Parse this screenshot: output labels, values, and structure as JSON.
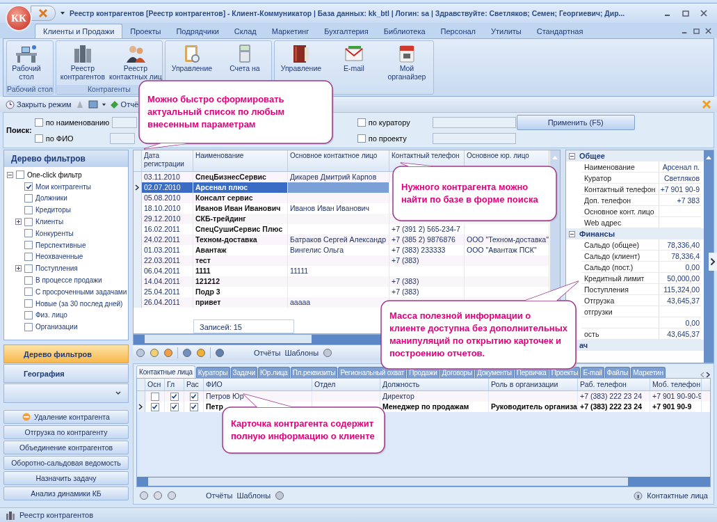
{
  "window": {
    "title": "Реестр контрагентов [Реестр контрагентов] - Клиент-Коммуникатор | База данных: kk_btl | Логин: sa | Здравствуйте: Светляков; Семен; Георгиевич; Дир..."
  },
  "logo": "КК",
  "ribbon": {
    "tabs": [
      {
        "label": "Клиенты и Продажи",
        "selected": true
      },
      {
        "label": "Проекты",
        "selected": false
      },
      {
        "label": "Подрядчики",
        "selected": false
      },
      {
        "label": "Склад",
        "selected": false
      },
      {
        "label": "Маркетинг",
        "selected": false
      },
      {
        "label": "Бухгалтерия",
        "selected": false
      },
      {
        "label": "Библиотека",
        "selected": false
      },
      {
        "label": "Персонал",
        "selected": false
      },
      {
        "label": "Утилиты",
        "selected": false
      },
      {
        "label": "Стандартная",
        "selected": false
      }
    ],
    "groups": [
      {
        "label": "Рабочий стол",
        "buttons": [
          {
            "label": "Рабочий стол",
            "kind": "desk"
          }
        ]
      },
      {
        "label": "Контрагенты",
        "buttons": [
          {
            "label": "Реестр контрагентов",
            "kind": "buildings"
          },
          {
            "label": "Реестр контактных лиц",
            "kind": "people"
          }
        ]
      },
      {
        "buttons": [
          {
            "label": "Управление",
            "kind": "clipboard"
          },
          {
            "label": "Счета на",
            "kind": "calculator"
          }
        ]
      },
      {
        "buttons": [
          {
            "label": "Управление",
            "kind": "book"
          },
          {
            "label": "E-mail",
            "kind": "envelope"
          },
          {
            "label": "Мой органайзер",
            "kind": "calendar"
          }
        ]
      }
    ]
  },
  "toolbar": {
    "close_mode": "Закрыть режим",
    "reports": "Отчё"
  },
  "search": {
    "label": "Поиск:",
    "filters": [
      {
        "label": "по наименованию",
        "checked": false
      },
      {
        "label": "по ФИО",
        "checked": false
      },
      {
        "label": "по куратору",
        "checked": false
      },
      {
        "label": "по проекту",
        "checked": false
      }
    ],
    "apply_button": "Применить (F5)"
  },
  "filter_tree": {
    "title": "Дерево фильтров",
    "root": {
      "label": "One-click фильтр",
      "checked": false,
      "expanded": true,
      "children": [
        {
          "label": "Мои контрагенты",
          "checked": true
        },
        {
          "label": "Должники",
          "checked": false
        },
        {
          "label": "Кредиторы",
          "checked": false
        },
        {
          "label": "Клиенты",
          "checked": false,
          "expanded": false
        },
        {
          "label": "Конкуренты",
          "checked": false
        },
        {
          "label": "Перспективные",
          "checked": false
        },
        {
          "label": "Неохваченные",
          "checked": false
        },
        {
          "label": "Поступления",
          "checked": false,
          "expanded": false
        },
        {
          "label": "В процессе продажи",
          "checked": false
        },
        {
          "label": "С просроченными задачами",
          "checked": false
        },
        {
          "label": "Новые (за 30 послед дней)",
          "checked": false
        },
        {
          "label": "Физ. лицо",
          "checked": false
        },
        {
          "label": "Организации",
          "checked": false
        }
      ]
    }
  },
  "navigation": [
    {
      "label": "Дерево фильтров",
      "selected": true
    },
    {
      "label": "География",
      "selected": false
    }
  ],
  "actions": [
    {
      "label": "Удаление контрагента"
    },
    {
      "label": "Отгрузка по контрагенту"
    },
    {
      "label": "Объединение контрагентов"
    },
    {
      "label": "Оборотно-сальдовая ведомость"
    },
    {
      "label": "Назначить задачу"
    },
    {
      "label": "Анализ динамики КБ"
    }
  ],
  "registry": {
    "columns": [
      "Дата регистрации",
      "Наименование",
      "Основное контактное лицо",
      "Контактный телефон",
      "Основное юр. лицо"
    ],
    "rows": [
      {
        "date": "03.11.2010",
        "name": "СпецБизнесСервис",
        "contact": "Дикарев Дмитрий Карпов",
        "selected": false
      },
      {
        "date": "02.07.2010",
        "name": "Арсенал плюс",
        "selected": true
      },
      {
        "date": "05.08.2010",
        "name": "Консалт сервис",
        "selected": false
      },
      {
        "date": "18.10.2010",
        "name": "Иванов  Иван Иванович",
        "contact": "Иванов Иван Иванович",
        "selected": false
      },
      {
        "date": "29.12.2010",
        "name": "СКБ-трейдинг",
        "selected": false
      },
      {
        "date": "16.02.2011",
        "name": "СпецСушиСервис Плюс",
        "phone": "+7 (391 2) 565-234-7",
        "selected": false
      },
      {
        "date": "24.02.2011",
        "name": "Техном-доставка",
        "contact": "Батраков Сергей Александр",
        "phone": "+7 (385 2) 9876876",
        "legal_entity": "ООО \"Техном-доставка\"",
        "selected": false
      },
      {
        "date": "01.03.2011",
        "name": "Авантаж",
        "contact": "Вингелис Ольга",
        "phone": "+7 (383) 233333",
        "legal_entity": "ООО \"Авантаж ПСК\"",
        "selected": false
      },
      {
        "date": "22.03.2011",
        "name": "тест",
        "phone": "+7 (383)",
        "selected": false
      },
      {
        "date": "06.04.2011",
        "name": "1111",
        "contact": "11111",
        "selected": false
      },
      {
        "date": "14.04.2011",
        "name": "121212",
        "phone": "+7 (383)",
        "selected": false
      },
      {
        "date": "25.04.2011",
        "name": "Подр 3",
        "phone": "+7 (383)",
        "selected": false
      },
      {
        "date": "26.04.2011",
        "name": "привет",
        "contact": "ааааа",
        "selected": false
      }
    ],
    "footer": "Записей:  15"
  },
  "grid_toolbar": {
    "reports": "Отчёты",
    "templates": "Шаблоны"
  },
  "details": {
    "sections": [
      {
        "title": "Общее",
        "expanded": true,
        "rows": [
          {
            "label": "Наименование",
            "value": "Арсенал п."
          },
          {
            "label": "Куратор",
            "value": "Светляков"
          },
          {
            "label": "Контактный телефон",
            "value": "+7 901 90-9"
          },
          {
            "label": "Доп. телефон",
            "value": "+7 383"
          },
          {
            "label": "Основное конт. лицо"
          },
          {
            "label": "Web адрес"
          }
        ]
      },
      {
        "title": "Финансы",
        "expanded": true,
        "rows": [
          {
            "label": "Сальдо (общее)",
            "value": "78,336,40"
          },
          {
            "label": "Сальдо (клиент)",
            "value": "78,336,4"
          },
          {
            "label": "Сальдо (пост.)",
            "value": "0,00"
          },
          {
            "label": "Кредитный лимит",
            "value": "50,000,00"
          },
          {
            "label": "Поступления",
            "value": "115,324,00"
          },
          {
            "label": "Отгрузка",
            "value": "43,645,37"
          },
          {
            "label": "отгрузки"
          },
          {
            "value": "0,00"
          },
          {
            "label": "ость",
            "value": "43,645,37"
          }
        ]
      },
      {
        "title": "ач"
      }
    ]
  },
  "contact_tabs": [
    {
      "label": "Контактные лица",
      "selected": true
    },
    {
      "label": "Кураторы",
      "selected": false
    },
    {
      "label": "Задачи",
      "selected": false
    },
    {
      "label": "Юр.лица",
      "selected": false
    },
    {
      "label": "Пл.реквизиты",
      "selected": false
    },
    {
      "label": "Региональный охват",
      "selected": false
    },
    {
      "label": "Продажи",
      "selected": false
    },
    {
      "label": "Договоры",
      "selected": false
    },
    {
      "label": "Документы",
      "selected": false
    },
    {
      "label": "Первичка",
      "selected": false
    },
    {
      "label": "Проекты",
      "selected": false
    },
    {
      "label": "E-mail",
      "selected": false
    },
    {
      "label": "Файлы",
      "selected": false
    },
    {
      "label": "Маркетин",
      "selected": false
    }
  ],
  "contacts": {
    "columns": [
      "Осн",
      "Гл",
      "Рас",
      "ФИО",
      "Отдел",
      "Должность",
      "Роль в организации",
      "Раб. телефон",
      "Моб. телефон"
    ],
    "rows": [
      {
        "checks": [
          false,
          true,
          true
        ],
        "name": "Петров Юр",
        "position": "Директор",
        "work_phone": "+7 (383) 222 23 24",
        "mobile_phone": "+7 901 90-90-9",
        "selected": false
      },
      {
        "checks": [
          true,
          true,
          true
        ],
        "name": "Петр",
        "position": "Менеджер по продажам",
        "role": "Руководитель организа",
        "work_phone": "+7 (383) 222 23 24",
        "mobile_phone": "+7 901 90-9",
        "selected": true
      }
    ]
  },
  "contacts_toolbar": {
    "reports": "Отчёты",
    "templates": "Шаблоны",
    "caption": "Контактные лица"
  },
  "status_bar": "Реестр контрагентов",
  "callouts": [
    {
      "text": "Можно быстро сформировать актуальный список по любым внесенным параметрам"
    },
    {
      "text": "Нужного контрагента можно найти по базе в форме поиска"
    },
    {
      "text": "Масса полезной информации о клиенте доступна без дополнительных манипуляций по открытию карточек и построению отчетов."
    },
    {
      "text": "Карточка контрагента содержит полную информацию о клиенте"
    }
  ]
}
